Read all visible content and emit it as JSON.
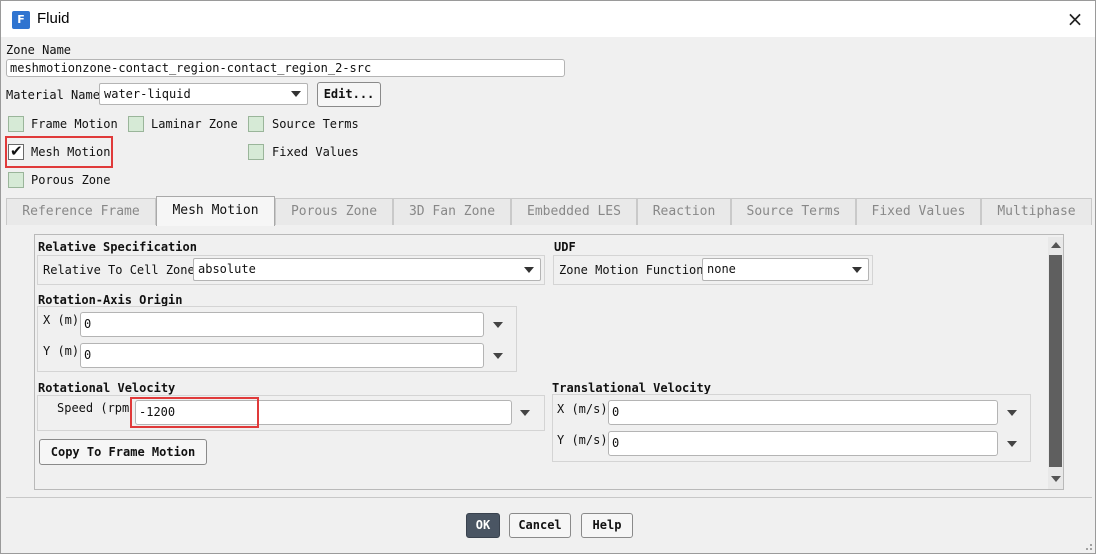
{
  "window": {
    "title": "Fluid",
    "app_icon": "F",
    "close_icon": "×"
  },
  "zone_name": {
    "label": "Zone Name",
    "value": "meshmotionzone-contact_region-contact_region_2-src"
  },
  "material": {
    "label": "Material Name",
    "value": "water-liquid",
    "edit_label": "Edit..."
  },
  "checkboxes": {
    "frame_motion": {
      "label": "Frame Motion",
      "checked": false
    },
    "laminar_zone": {
      "label": "Laminar Zone",
      "checked": false
    },
    "source_terms": {
      "label": "Source Terms",
      "checked": false
    },
    "mesh_motion": {
      "label": "Mesh Motion",
      "checked": true,
      "mark": "✔"
    },
    "fixed_values": {
      "label": "Fixed Values",
      "checked": false
    },
    "porous_zone": {
      "label": "Porous Zone",
      "checked": false
    }
  },
  "tabs": [
    {
      "label": "Reference Frame",
      "active": false
    },
    {
      "label": "Mesh Motion",
      "active": true
    },
    {
      "label": "Porous Zone",
      "active": false
    },
    {
      "label": "3D Fan Zone",
      "active": false
    },
    {
      "label": "Embedded LES",
      "active": false
    },
    {
      "label": "Reaction",
      "active": false
    },
    {
      "label": "Source Terms",
      "active": false
    },
    {
      "label": "Fixed Values",
      "active": false
    },
    {
      "label": "Multiphase",
      "active": false
    }
  ],
  "relative_spec": {
    "heading": "Relative Specification",
    "label": "Relative To Cell Zone",
    "value": "absolute"
  },
  "udf": {
    "heading": "UDF",
    "label": "Zone Motion Function",
    "value": "none"
  },
  "rotation_origin": {
    "heading": "Rotation-Axis Origin",
    "x_label": "X (m)",
    "x_value": "0",
    "y_label": "Y (m)",
    "y_value": "0"
  },
  "rotational_velocity": {
    "heading": "Rotational Velocity",
    "speed_label": "Speed (rpm",
    "speed_value": "-1200"
  },
  "translational_velocity": {
    "heading": "Translational Velocity",
    "x_label": "X (m/s)",
    "x_value": "0",
    "y_label": "Y (m/s)",
    "y_value": "0"
  },
  "copy_button": "Copy To Frame Motion",
  "footer": {
    "ok": "OK",
    "cancel": "Cancel",
    "help": "Help"
  },
  "colors": {
    "highlight": "#e03a3a",
    "checkbox_fill": "#d6ead6",
    "ok_button": "#4a5563"
  }
}
